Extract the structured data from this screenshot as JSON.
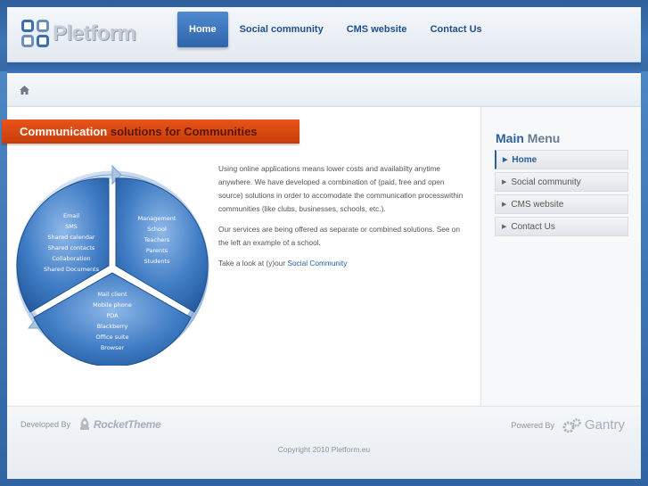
{
  "header": {
    "logo_text": "Pletform",
    "nav": [
      {
        "label": "Home"
      },
      {
        "label": "Social community"
      },
      {
        "label": "CMS website"
      },
      {
        "label": "Contact Us"
      }
    ]
  },
  "content": {
    "heading_part1": "Communication",
    "heading_part2": "solutions for Communities",
    "diagram": {
      "segment1": [
        "Email",
        "SMS",
        "Shared calendar",
        "Shared contacts",
        "Collaboration",
        "Shared Documents"
      ],
      "segment2": [
        "Management",
        "School",
        "Teachers",
        "Parents",
        "Students"
      ],
      "segment3": [
        "Mail client",
        "Mobile phone",
        "PDA",
        "Blackberry",
        "Office suite",
        "Browser"
      ]
    },
    "paragraph1": "Using online applications means lower costs and availabilty anytime anywhere. We have developed a combination of (paid, free and open source) solutions in order to accomodate the communication processwithin communities (like clubs, businesses, schools, etc.).",
    "paragraph2": "Our services are being offered as separate or combined solutions. See on the left an example of a school.",
    "paragraph3_prefix": "Take a look at (y)our",
    "paragraph3_link": "Social Community"
  },
  "sidebar": {
    "title_part1": "Main",
    "title_part2": "Menu",
    "items": [
      {
        "label": "Home"
      },
      {
        "label": "Social community"
      },
      {
        "label": "CMS website"
      },
      {
        "label": "Contact Us"
      }
    ]
  },
  "footer": {
    "developed_by": "Developed By",
    "rocket_text": "RocketTheme",
    "powered_by": "Powered By",
    "gantry_text": "Gantry",
    "copyright": "Copyright 2010 Pletform.eu"
  },
  "colors": {
    "accent": "#2e64aa",
    "heading_orange": "#e8541a",
    "link": "#1f5fa6"
  }
}
